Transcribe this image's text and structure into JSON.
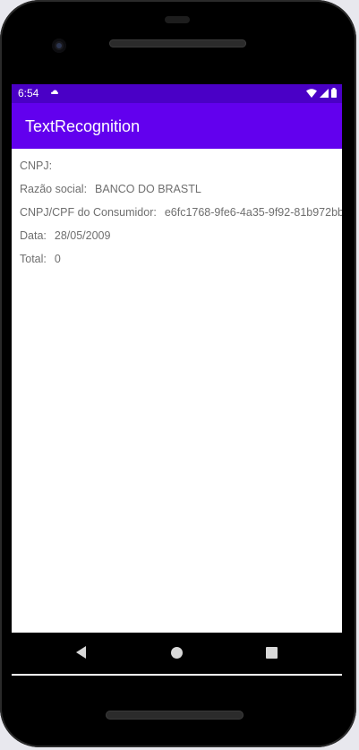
{
  "status_bar": {
    "time": "6:54",
    "notification_icon": "cloud-icon",
    "icons": [
      "wifi-icon",
      "signal-icon",
      "battery-icon"
    ]
  },
  "app_bar": {
    "title": "TextRecognition"
  },
  "fields": {
    "cnpj": {
      "label": "CNPJ:",
      "value": ""
    },
    "razao_social": {
      "label": "Razão social:",
      "value": "BANCO DO BRASTL"
    },
    "cnpj_cpf_consumidor": {
      "label": "CNPJ/CPF do Consumidor:",
      "value": "e6fc1768-9fe6-4a35-9f92-81b972bb"
    },
    "data": {
      "label": "Data:",
      "value": "28/05/2009"
    },
    "total": {
      "label": "Total:",
      "value": "0"
    }
  },
  "navigation": {
    "items": [
      "back-icon",
      "home-icon",
      "recents-icon"
    ]
  },
  "colors": {
    "status_bar": "#4a00c6",
    "app_bar": "#6200ee",
    "text": "#6f6f6f"
  }
}
